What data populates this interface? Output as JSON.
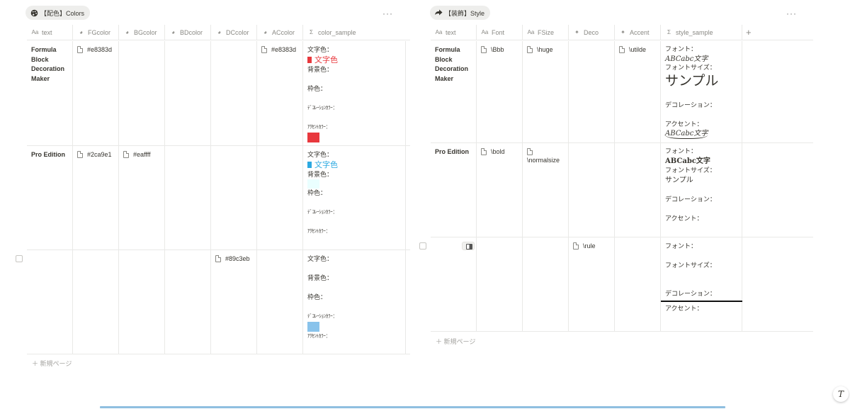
{
  "colors_db": {
    "title": "【配色】Colors",
    "icon": "palette-icon",
    "more": "···",
    "columns": [
      {
        "icon": "Aa",
        "label": "text"
      },
      {
        "icon": "palette",
        "label": "FGcolor"
      },
      {
        "icon": "palette",
        "label": "BGcolor"
      },
      {
        "icon": "palette",
        "label": "BDcolor"
      },
      {
        "icon": "palette",
        "label": "DCcolor"
      },
      {
        "icon": "palette",
        "label": "ACcolor"
      },
      {
        "icon": "Σ",
        "label": "color_sample"
      }
    ],
    "rows": [
      {
        "text": "Formula Block Decoration Maker",
        "fg": "#e8383d",
        "bg": "",
        "bd": "",
        "dc": "",
        "ac": "#e8383d",
        "sample": {
          "fg_label": "文字色：",
          "fg_text": "文字色",
          "fg_color": "#e8383d",
          "bg_label": "背景色：",
          "bd_label": "枠色：",
          "dc_label": "ﾃﾞｺﾚｰｼｮﾝｶﾗｰ：",
          "ac_label": "ｱｸｾﾝﾄｶﾗｰ：",
          "ac_color": "#e8383d"
        }
      },
      {
        "text": "Pro Edition",
        "fg": "#2ca9e1",
        "bg": "#eaffff",
        "bd": "",
        "dc": "",
        "ac": "",
        "sample": {
          "fg_label": "文字色：",
          "fg_text": "文字色",
          "fg_color": "#2ca9e1",
          "bg_label": "背景色：",
          "bg_color": "#eaffff",
          "bd_label": "枠色：",
          "dc_label": "ﾃﾞｺﾚｰｼｮﾝｶﾗｰ：",
          "ac_label": "ｱｸｾﾝﾄｶﾗｰ："
        }
      },
      {
        "text": "",
        "fg": "",
        "bg": "",
        "bd": "",
        "dc": "#89c3eb",
        "ac": "",
        "sample": {
          "fg_label": "文字色：",
          "bg_label": "背景色：",
          "bd_label": "枠色：",
          "dc_label": "ﾃﾞｺﾚｰｼｮﾝｶﾗｰ：",
          "dc_color": "#89c3eb",
          "ac_label": "ｱｸｾﾝﾄｶﾗｰ："
        }
      }
    ],
    "new_page": "新規ページ"
  },
  "style_db": {
    "title": "【装飾】Style",
    "icon": "arrow-icon",
    "more": "···",
    "add_column": "+",
    "columns": [
      {
        "icon": "Aa",
        "label": "text"
      },
      {
        "icon": "Aa",
        "label": "Font"
      },
      {
        "icon": "Aa",
        "label": "FSize"
      },
      {
        "icon": "sparkle",
        "label": "Deco"
      },
      {
        "icon": "sparkle",
        "label": "Accent"
      },
      {
        "icon": "Σ",
        "label": "style_sample"
      }
    ],
    "rows": [
      {
        "text": "Formula Block Decoration Maker",
        "font": "\\Bbb",
        "fsize": "\\huge",
        "deco": "",
        "accent": "\\utilde",
        "sample": {
          "font_label": "フォント：",
          "font_sample": "ABCabc文字",
          "size_label": "フォントサイズ：",
          "size_sample": "サンプル",
          "deco_label": "デコレーション：",
          "accent_label": "アクセント：",
          "accent_sample": "ABCabc文字"
        }
      },
      {
        "text": "Pro Edition",
        "font": "\\bold",
        "fsize": "\\normalsize",
        "deco": "",
        "accent": "",
        "sample": {
          "font_label": "フォント：",
          "font_sample": "ABCabc文字",
          "size_label": "フォントサイズ：",
          "size_sample": "サンプル",
          "deco_label": "デコレーション：",
          "accent_label": "アクセント："
        }
      },
      {
        "text": "",
        "font": "",
        "fsize": "",
        "deco": "\\rule",
        "accent": "",
        "sample": {
          "font_label": "フォント：",
          "size_label": "フォントサイズ：",
          "deco_label": "デコレーション：",
          "accent_label": "アクセント："
        }
      }
    ],
    "new_page": "新規ページ"
  },
  "corner_button": "T"
}
